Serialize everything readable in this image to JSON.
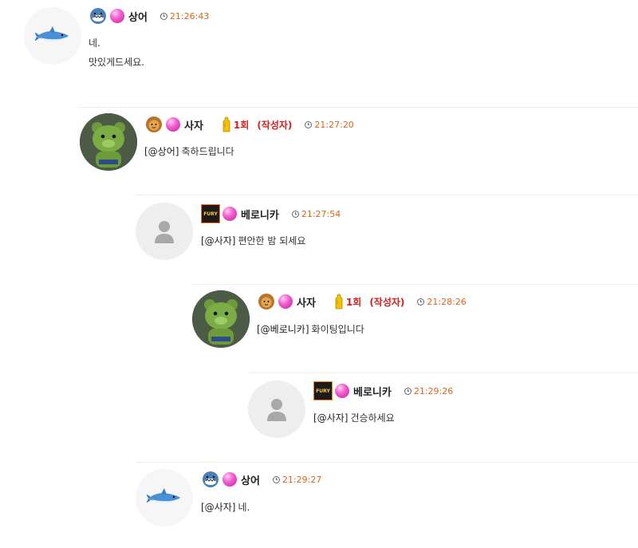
{
  "comments": [
    {
      "nick": "상어",
      "time": "21:26:43",
      "lines": [
        "네.",
        "맛있게드세요."
      ],
      "avatar": "shark-avatar"
    },
    {
      "nick": "사자",
      "time": "21:27:20",
      "count": "1회",
      "author": "(작성자)",
      "mention": "[@상어]",
      "text": "축하드립니다",
      "avatar": "green-bear-avatar"
    },
    {
      "nick": "베로니카",
      "time": "21:27:54",
      "mention": "[@사자]",
      "text": "편안한 밤 되세요",
      "avatar": "default-user-avatar",
      "level_badge": "FURY"
    },
    {
      "nick": "사자",
      "time": "21:28:26",
      "count": "1회",
      "author": "(작성자)",
      "mention": "[@베로니카]",
      "text": "화이팅입니다",
      "avatar": "green-bear-avatar"
    },
    {
      "nick": "베로니카",
      "time": "21:29:26",
      "mention": "[@사자]",
      "text": "건승하세요",
      "avatar": "default-user-avatar",
      "level_badge": "FURY"
    },
    {
      "nick": "상어",
      "time": "21:29:27",
      "mention": "[@사자]",
      "text": "네.",
      "avatar": "shark-avatar"
    }
  ],
  "colors": {
    "time": "#e0651a",
    "author": "#d71f1f",
    "gem": "#e64ac6",
    "fury_border": "#ff7a14"
  }
}
